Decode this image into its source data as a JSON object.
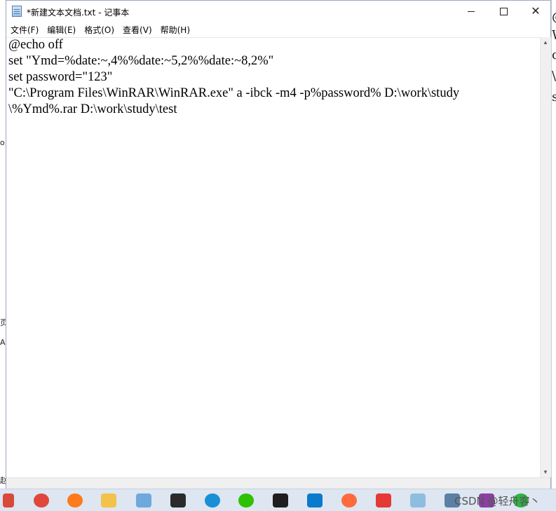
{
  "window": {
    "title": "*新建文本文档.txt - 记事本",
    "controls": {
      "minimize": "—",
      "maximize": "",
      "close": "✕"
    }
  },
  "menu": {
    "items": [
      "文件(F)",
      "编辑(E)",
      "格式(O)",
      "查看(V)",
      "帮助(H)"
    ]
  },
  "editor": {
    "lines": [
      "@echo off",
      "set \"Ymd=%date:~,4%%date:~5,2%%date:~8,2%\"",
      "set password=\"123\"",
      "\"C:\\Program Files\\WinRAR\\WinRAR.exe\" a -ibck -m4 -p%password% D:\\work\\study",
      "\\%Ymd%.rar D:\\work\\study\\test"
    ]
  },
  "background_fragments": {
    "left": [
      "o",
      "页",
      "A",
      "赵"
    ],
    "right": [
      "@",
      "W",
      "cl",
      "\\",
      "s"
    ]
  },
  "taskbar": {
    "icons": [
      {
        "name": "pinned-app-icon",
        "color": "#d84a3a"
      },
      {
        "name": "snipping-tool-icon",
        "color": "#e0473c"
      },
      {
        "name": "firefox-icon",
        "color": "#ff7a1a"
      },
      {
        "name": "file-explorer-icon",
        "color": "#f3c24a"
      },
      {
        "name": "laptop-app-icon",
        "color": "#6fa8dc"
      },
      {
        "name": "sticky-app-icon",
        "color": "#2b2b2b"
      },
      {
        "name": "edge-icon",
        "color": "#1a8fd6"
      },
      {
        "name": "wechat-icon",
        "color": "#2dc100"
      },
      {
        "name": "jetbrains-icon",
        "color": "#1e1e1e"
      },
      {
        "name": "vscode-icon",
        "color": "#0a7acc"
      },
      {
        "name": "browser-feather-icon",
        "color": "#ff6a3d"
      },
      {
        "name": "wps-icon",
        "color": "#e53935"
      },
      {
        "name": "notepad-icon",
        "color": "#8fbde0"
      },
      {
        "name": "network-icon",
        "color": "#5d7fa3"
      },
      {
        "name": "winrar-icon",
        "color": "#8b3fa0"
      },
      {
        "name": "refresh-green-icon",
        "color": "#2fb344"
      }
    ],
    "watermark": "CSDN @轻舟客丶"
  }
}
